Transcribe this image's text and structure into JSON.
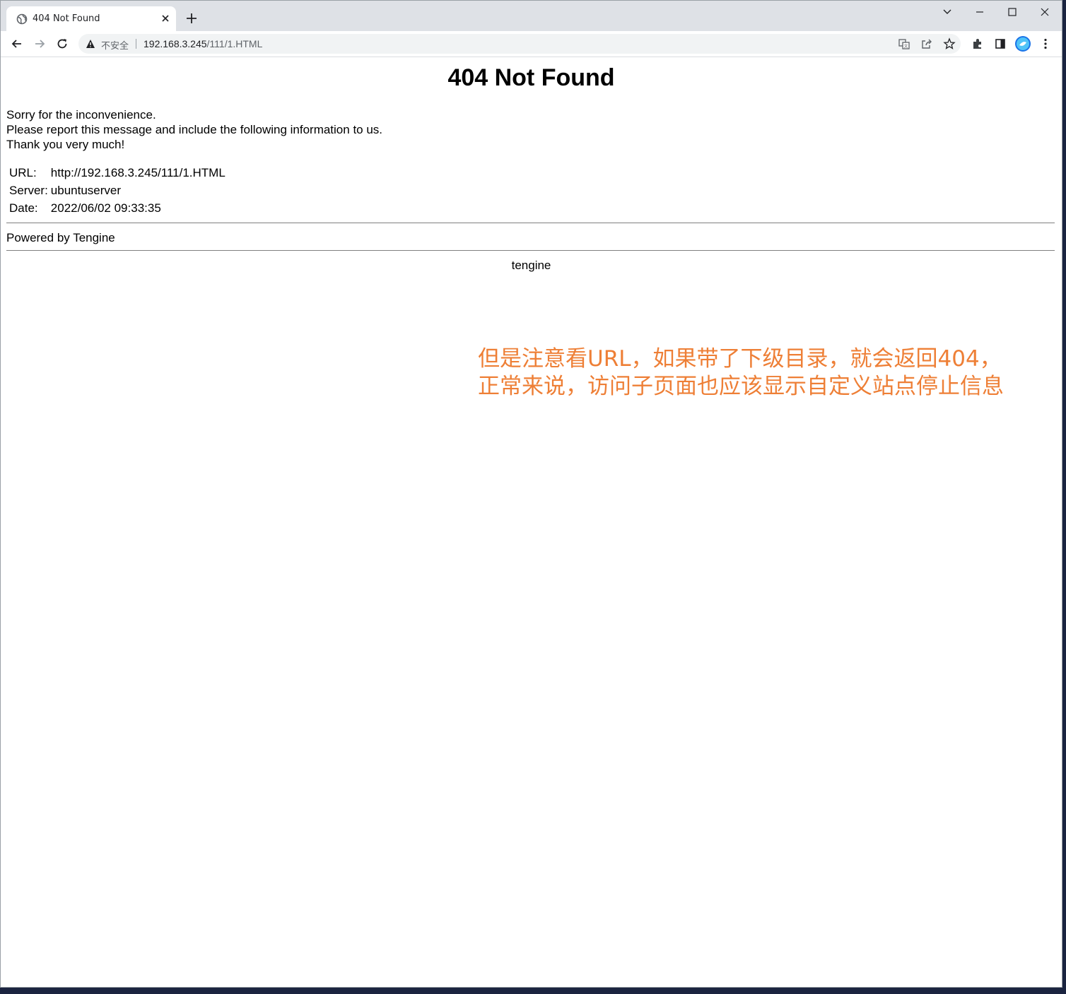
{
  "browser": {
    "tab": {
      "title": "404 Not Found",
      "favicon": "globe-icon"
    },
    "toolbar": {
      "security_label": "不安全",
      "url_host": "192.168.3.245",
      "url_path": "/111/1.HTML"
    },
    "icons": {
      "back": "arrow-left-icon",
      "forward": "arrow-right-icon",
      "reload": "reload-icon",
      "translate": "translate-icon",
      "share": "share-icon",
      "bookmark": "star-icon",
      "extensions": "puzzle-icon",
      "side_panel": "side-panel-icon",
      "profile": "profile-avatar-icon",
      "menu": "kebab-menu-icon",
      "tab_list": "chevron-down-icon",
      "minimize": "minimize-icon",
      "maximize": "maximize-icon",
      "close_window": "close-icon"
    }
  },
  "page": {
    "heading": "404 Not Found",
    "messages": [
      "Sorry for the inconvenience.",
      "Please report this message and include the following information to us.",
      "Thank you very much!"
    ],
    "info": {
      "url_label": "URL:",
      "url_value": "http://192.168.3.245/111/1.HTML",
      "server_label": "Server:",
      "server_value": "ubuntuserver",
      "date_label": "Date:",
      "date_value": "2022/06/02 09:33:35"
    },
    "powered_by": "Powered by Tengine",
    "footer": "tengine"
  },
  "annotation": {
    "line1": "但是注意看URL，如果带了下级目录，就会返回404，",
    "line2": "正常来说，访问子页面也应该显示自定义站点停止信息",
    "color": "#ee7f36"
  }
}
